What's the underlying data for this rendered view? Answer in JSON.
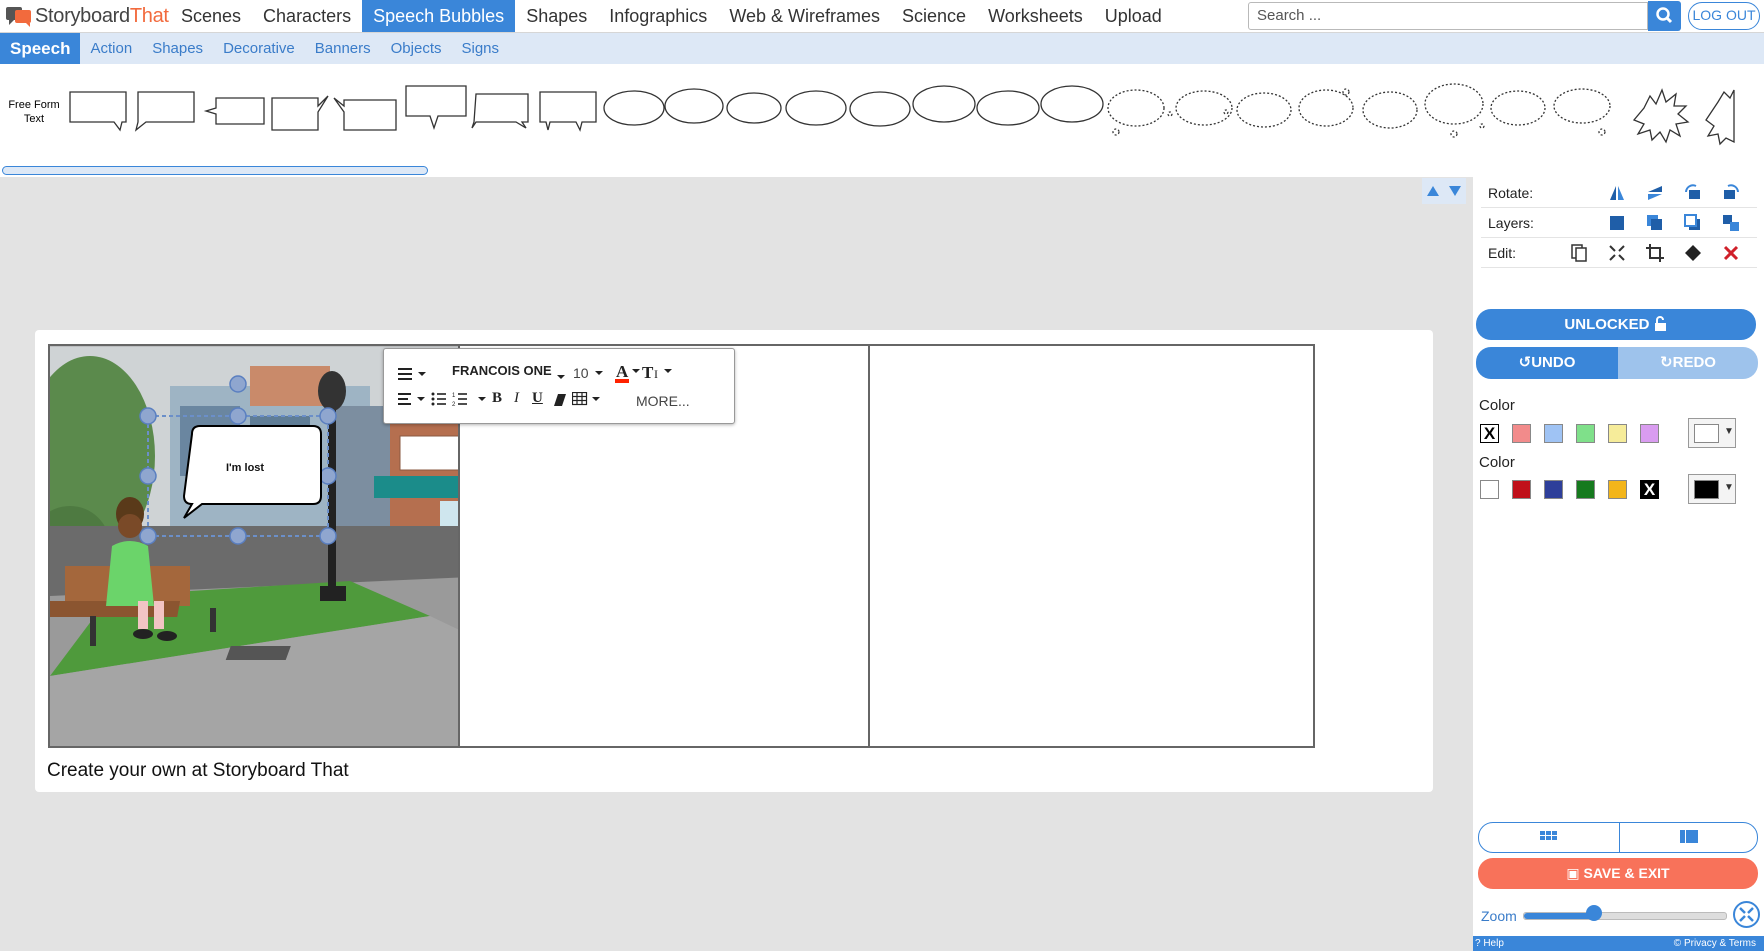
{
  "app": {
    "logo_text_a": "Storyboard",
    "logo_text_b": "That"
  },
  "nav": {
    "items": [
      "Scenes",
      "Characters",
      "Speech Bubbles",
      "Shapes",
      "Infographics",
      "Web & Wireframes",
      "Science",
      "Worksheets",
      "Upload"
    ],
    "active_index": 2
  },
  "search": {
    "placeholder": "Search ..."
  },
  "logout_label": "LOG OUT",
  "subnav": {
    "items": [
      "Speech",
      "Action",
      "Shapes",
      "Decorative",
      "Banners",
      "Objects",
      "Signs"
    ],
    "active_index": 0
  },
  "palette": {
    "freeform_label": "Free Form\nText"
  },
  "board": {
    "caption": "Create your own at Storyboard That",
    "bubble_text": "I'm lost"
  },
  "text_toolbar": {
    "font": "FRANCOIS ONE",
    "size": "10",
    "more_label": "MORE..."
  },
  "right_panel": {
    "rotate_label": "Rotate:",
    "layers_label": "Layers:",
    "edit_label": "Edit:",
    "unlocked_label": "UNLOCKED",
    "undo_label": "UNDO",
    "redo_label": "REDO",
    "color_label_1": "Color",
    "color_label_2": "Color",
    "fill_colors": [
      "none",
      "#f28b8b",
      "#9fc3f4",
      "#7fe08a",
      "#f6ec9a",
      "#d99cf0"
    ],
    "outline_colors": [
      "#ffffff",
      "#c0101a",
      "#2e3f9a",
      "#167a1e",
      "#f3b51a",
      "none"
    ],
    "fill_selected": "#ffffff",
    "outline_selected": "#000000",
    "save_label": "SAVE & EXIT",
    "zoom_label": "Zoom",
    "zoom_level": 0.35,
    "help_label": "? Help",
    "privacy_label": "© Privacy & Terms"
  },
  "colors": {
    "accent": "#3a86d9",
    "save": "#f8725a",
    "brand_orange": "#f26a3d"
  }
}
